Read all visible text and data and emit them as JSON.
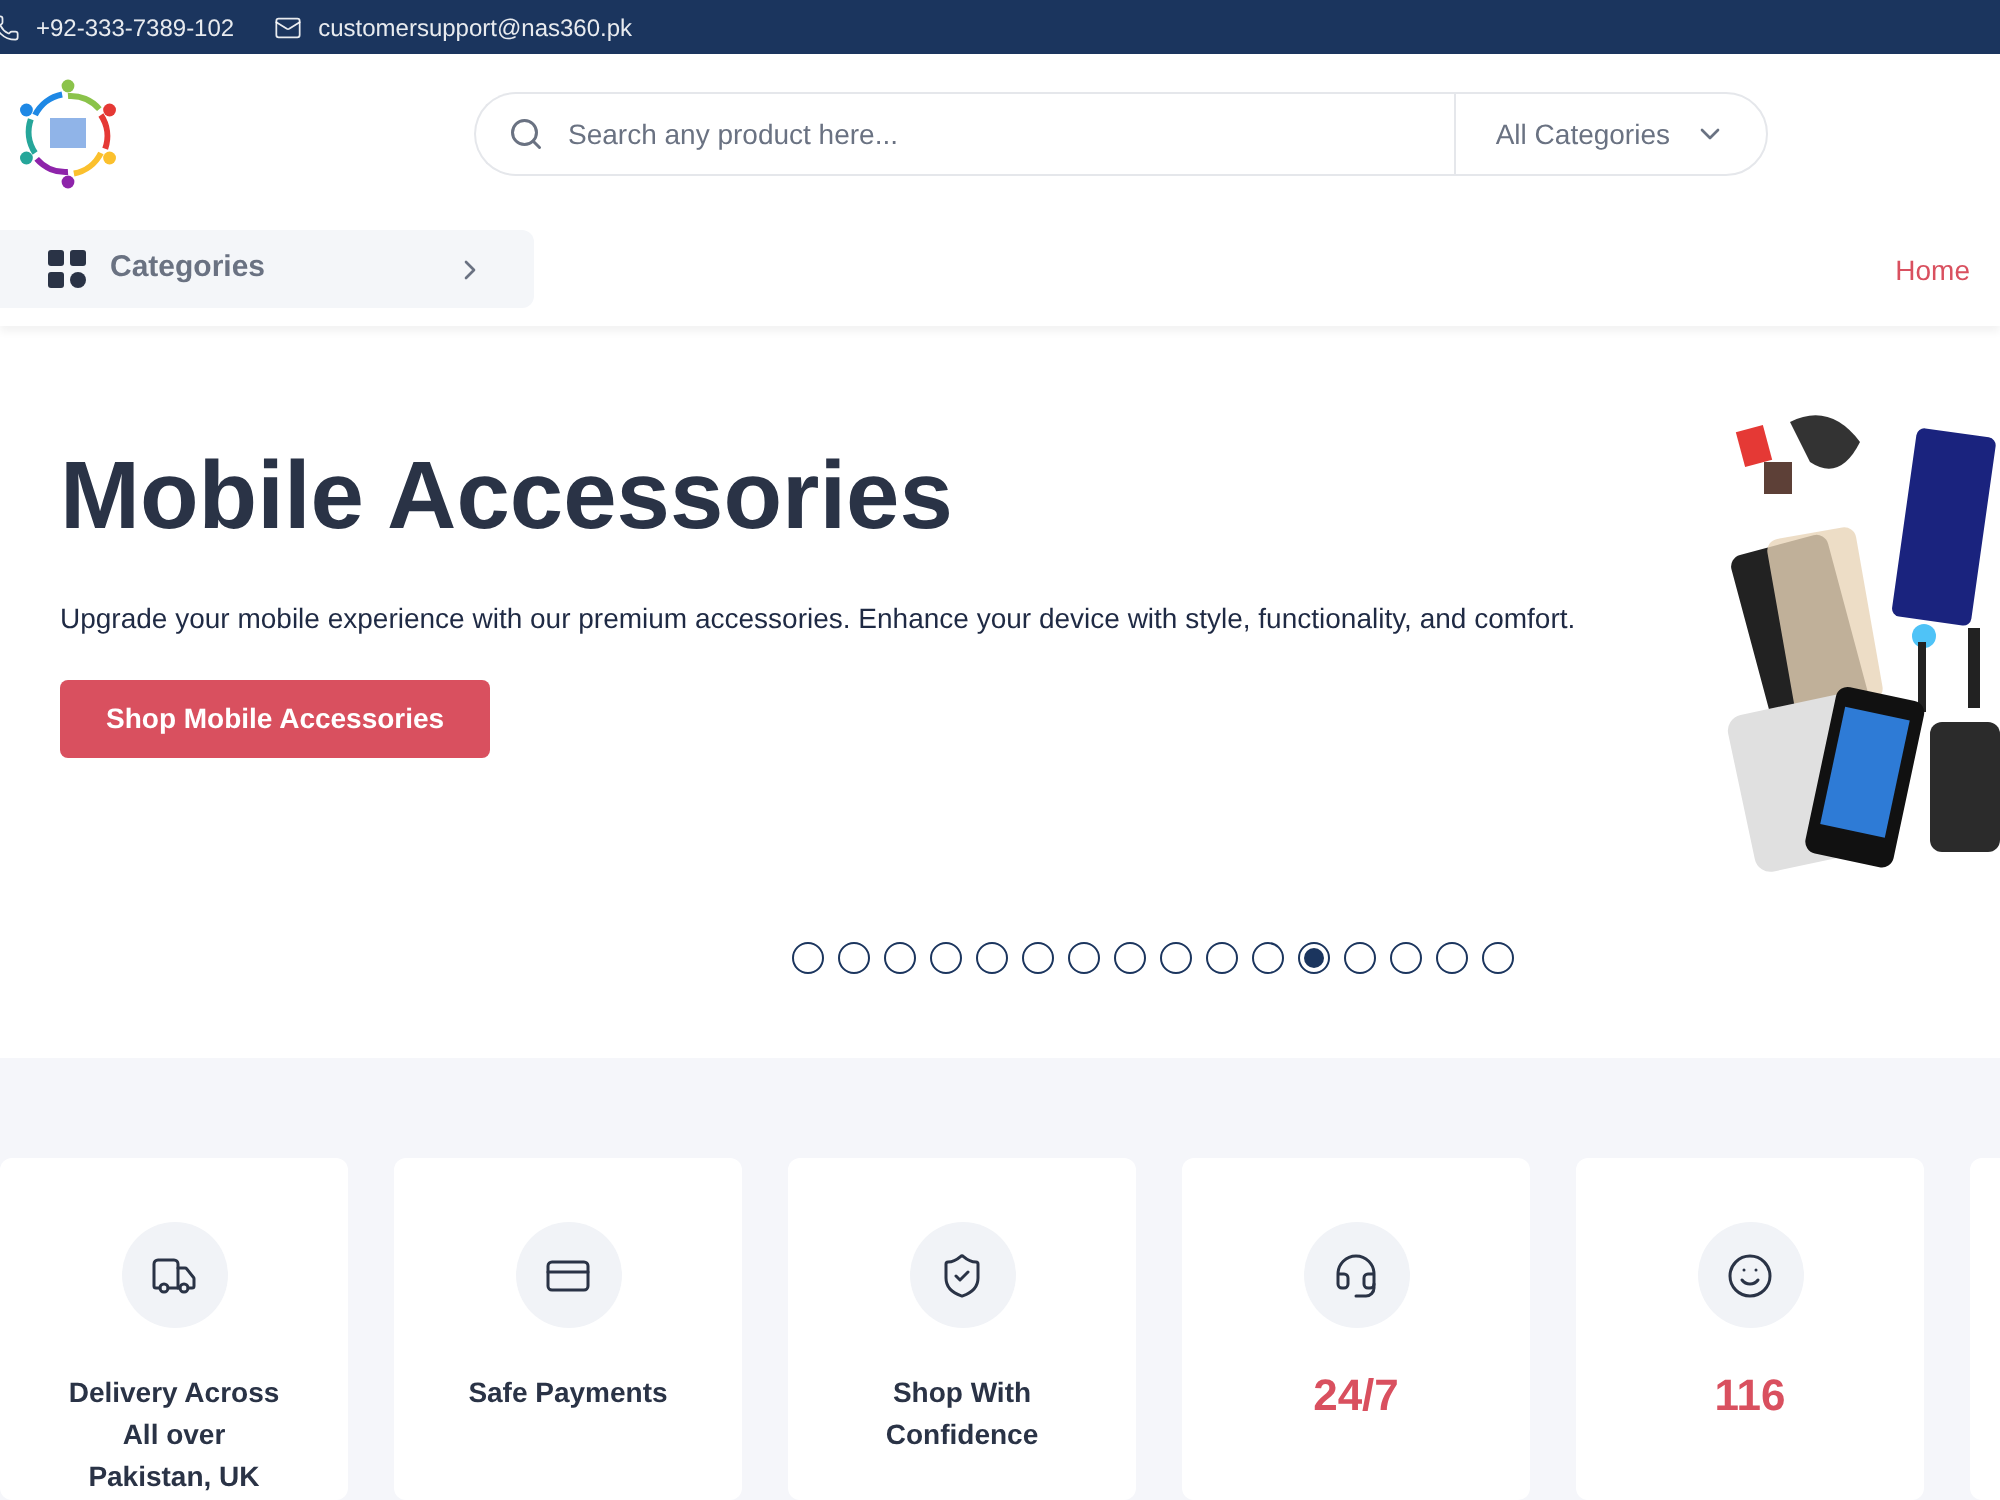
{
  "top_bar": {
    "phone": "+92-333-7389-102",
    "email": "customersupport@nas360.pk"
  },
  "search": {
    "placeholder": "Search any product here...",
    "category": "All Categories"
  },
  "categories_button": {
    "label": "Categories"
  },
  "nav": [
    {
      "label": "Home",
      "selected": true
    }
  ],
  "hero": {
    "title": "Mobile Accessories",
    "text": "Upgrade your mobile experience with our premium accessories. Enhance your device with style, functionality, and comfort.",
    "button": "Shop Mobile Accessories"
  },
  "slides": [
    {
      "selected": false
    },
    {
      "selected": false
    },
    {
      "selected": false
    },
    {
      "selected": false
    },
    {
      "selected": false
    },
    {
      "selected": false
    },
    {
      "selected": false
    },
    {
      "selected": false
    },
    {
      "selected": false
    },
    {
      "selected": false
    },
    {
      "selected": false
    },
    {
      "selected": true
    },
    {
      "selected": false
    },
    {
      "selected": false
    },
    {
      "selected": false
    },
    {
      "selected": false
    }
  ],
  "features": [
    {
      "kind": "label",
      "lines": [
        "Delivery Across",
        "All over",
        "Pakistan, UK"
      ]
    },
    {
      "kind": "label",
      "lines": [
        "Safe Payments"
      ]
    },
    {
      "kind": "label",
      "lines": [
        "Shop With",
        "Confidence"
      ]
    },
    {
      "kind": "stat",
      "lines": [
        "24/7"
      ]
    },
    {
      "kind": "stat",
      "lines": [
        "116"
      ]
    }
  ]
}
